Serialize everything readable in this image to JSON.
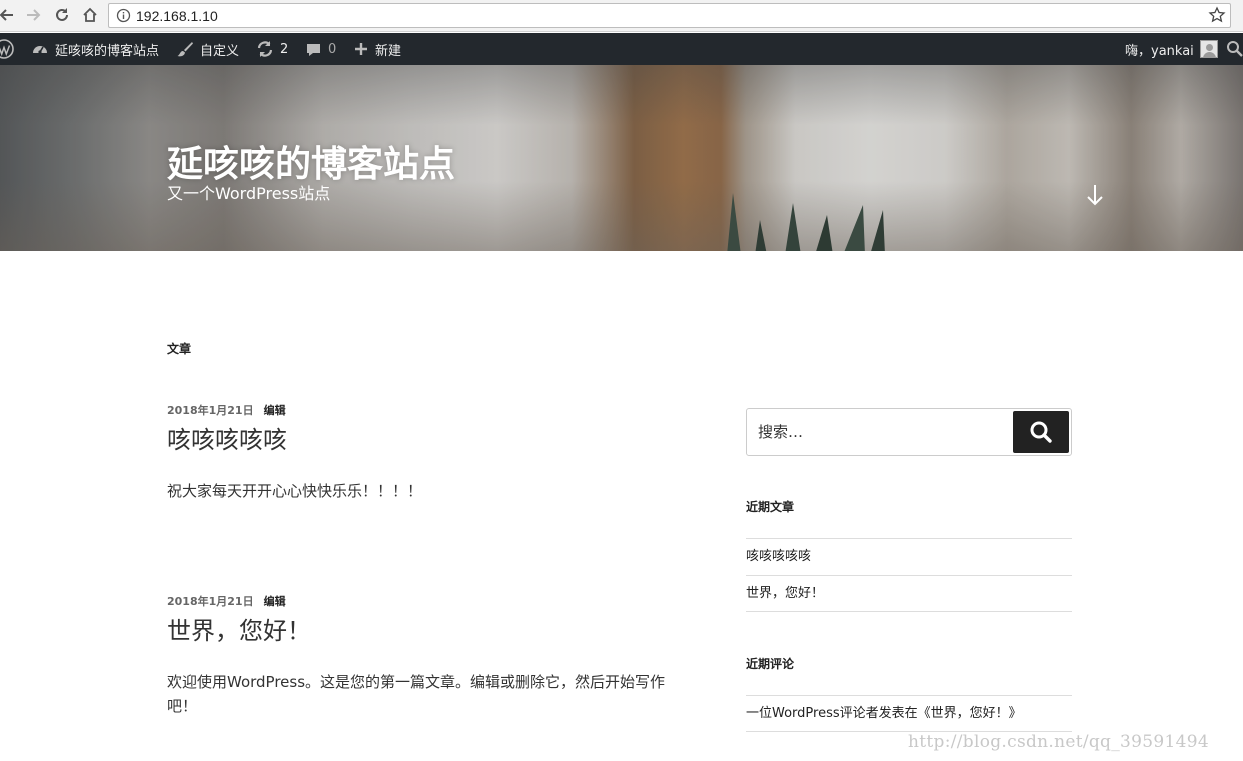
{
  "browser": {
    "url": "192.168.1.10"
  },
  "admin_bar": {
    "site_name": "延咳咳的博客站点",
    "customize": "自定义",
    "updates_count": "2",
    "comments_count": "0",
    "new_label": "新建",
    "greeting": "嗨，yankai"
  },
  "header": {
    "site_title": "延咳咳的博客站点",
    "site_description": "又一个WordPress站点"
  },
  "main": {
    "page_title": "文章",
    "posts": [
      {
        "date": "2018年1月21日",
        "edit_label": "编辑",
        "title": "咳咳咳咳咳",
        "excerpt": "祝大家每天开开心心快快乐乐！！！！"
      },
      {
        "date": "2018年1月21日",
        "edit_label": "编辑",
        "title": "世界，您好！",
        "excerpt": "欢迎使用WordPress。这是您的第一篇文章。编辑或删除它，然后开始写作吧！"
      }
    ]
  },
  "sidebar": {
    "search_placeholder": "搜索…",
    "recent_posts_title": "近期文章",
    "recent_posts": [
      "咳咳咳咳咳",
      "世界，您好！"
    ],
    "recent_comments_title": "近期评论",
    "recent_comments": [
      "一位WordPress评论者发表在《世界，您好！》"
    ]
  },
  "watermark": "http://blog.csdn.net/qq_39591494",
  "colors": {
    "admin_bar_bg": "#23282d",
    "search_button_bg": "#222222"
  }
}
